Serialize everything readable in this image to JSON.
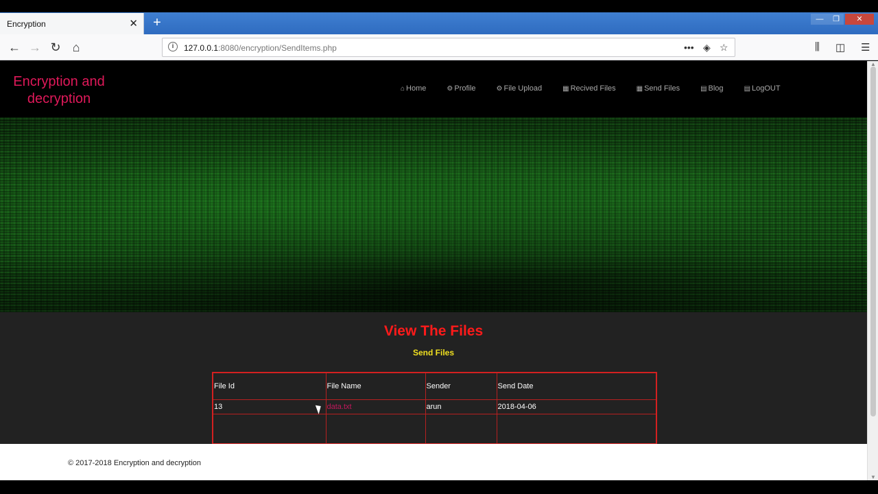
{
  "browser": {
    "tab_title": "Encryption",
    "tab_close": "✕",
    "new_tab": "+",
    "url_host": "127.0.0.1",
    "url_rest": ":8080/encryption/SendItems.php",
    "win_min": "—",
    "win_max": "❐",
    "win_close": "✕"
  },
  "site": {
    "logo_line1": "Encryption and",
    "logo_line2": "decryption",
    "nav": [
      {
        "icon": "⌂",
        "label": "Home"
      },
      {
        "icon": "⚙",
        "label": "Profile"
      },
      {
        "icon": "⚙",
        "label": "File Upload"
      },
      {
        "icon": "▦",
        "label": "Recived Files"
      },
      {
        "icon": "▦",
        "label": "Send Files"
      },
      {
        "icon": "▤",
        "label": "Blog"
      },
      {
        "icon": "▤",
        "label": "LogOUT"
      }
    ]
  },
  "main": {
    "title": "View The Files",
    "subtitle": "Send Files",
    "table": {
      "headers": [
        "File Id",
        "File Name",
        "Sender",
        "Send Date"
      ],
      "rows": [
        {
          "id": "13",
          "name": "data.txt",
          "sender": "arun",
          "date": "2018-04-06"
        }
      ]
    }
  },
  "footer": {
    "text": "© 2017-2018 Encryption and decryption"
  }
}
